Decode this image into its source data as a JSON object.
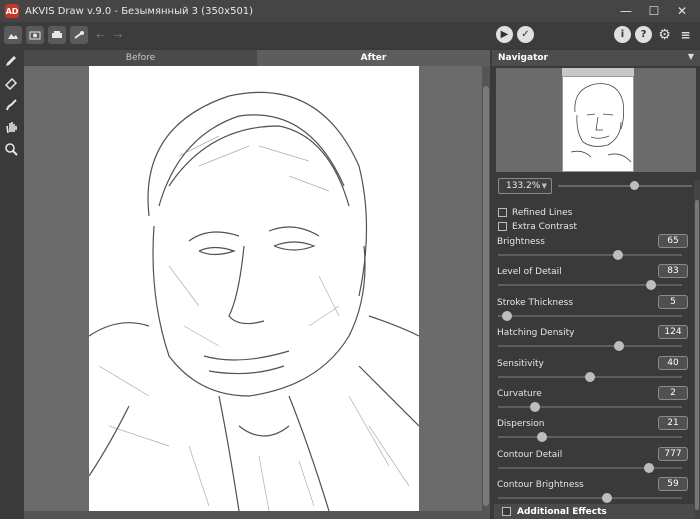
{
  "window": {
    "title": "AKVIS Draw v.9.0 - Безымянный 3 (350x501)",
    "logo_text": "AD",
    "controls": {
      "minimize": "—",
      "maximize": "☐",
      "close": "✕"
    }
  },
  "toolbar": {
    "buttons": [
      "open-image-icon",
      "save-image-icon",
      "print-icon",
      "share-icon"
    ],
    "undo": "←",
    "redo": "→",
    "run": "▶",
    "apply": "✓",
    "info": "i",
    "help": "?",
    "settings": "⚙",
    "preferences": "≡"
  },
  "tools": [
    "pencil-icon",
    "eraser-icon",
    "brush-icon",
    "hand-icon",
    "zoom-icon"
  ],
  "tabs": {
    "before": "Before",
    "after": "After"
  },
  "navigator": {
    "title": "Navigator",
    "zoom": "133.2%"
  },
  "checkboxes": {
    "refined_lines": "Refined Lines",
    "extra_contrast": "Extra Contrast"
  },
  "params": [
    {
      "label": "Brightness",
      "value": "65",
      "fraction": 0.65
    },
    {
      "label": "Level of Detail",
      "value": "83",
      "fraction": 0.83
    },
    {
      "label": "Stroke Thickness",
      "value": "5",
      "fraction": 0.05
    },
    {
      "label": "Hatching Density",
      "value": "124",
      "fraction": 0.66
    },
    {
      "label": "Sensitivity",
      "value": "40",
      "fraction": 0.5
    },
    {
      "label": "Curvature",
      "value": "2",
      "fraction": 0.2
    },
    {
      "label": "Dispersion",
      "value": "21",
      "fraction": 0.24
    },
    {
      "label": "Contour Detail",
      "value": "777",
      "fraction": 0.82
    },
    {
      "label": "Contour Brightness",
      "value": "59",
      "fraction": 0.59
    }
  ],
  "additional_effects": "Additional Effects",
  "colors": {
    "accent_logo": "#c0392b",
    "panel_bg": "#3a3a3a",
    "canvas_bg": "#ffffff"
  }
}
